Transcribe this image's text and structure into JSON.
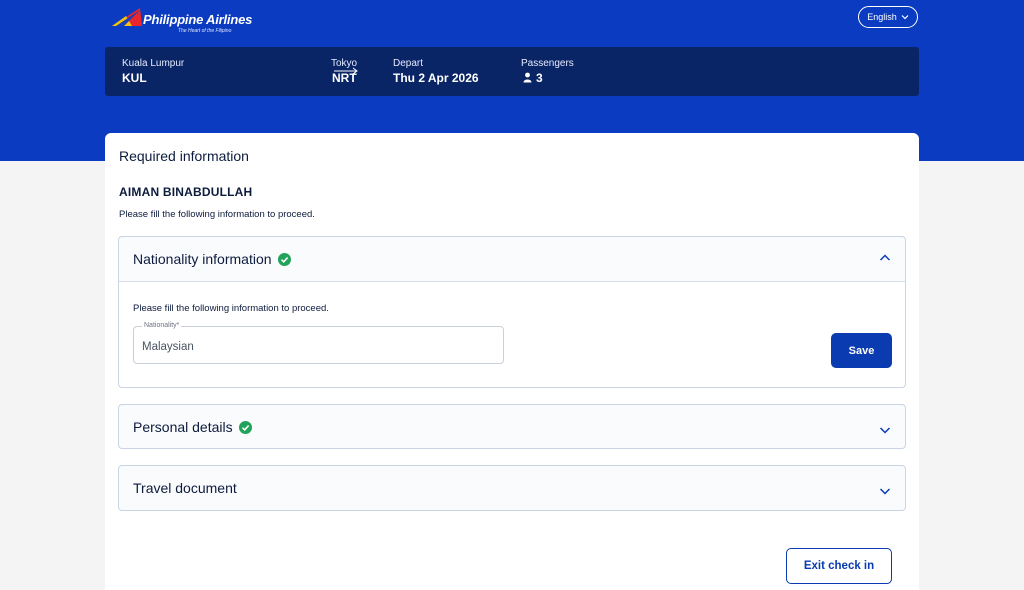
{
  "header": {
    "brand": "Philippine Airlines",
    "tagline": "The Heart of the Filipino",
    "language": "English"
  },
  "trip": {
    "origin_city": "Kuala Lumpur",
    "origin_code": "KUL",
    "destination_city": "Tokyo",
    "destination_code": "NRT",
    "depart_label": "Depart",
    "depart_date": "Thu 2 Apr 2026",
    "passengers_label": "Passengers",
    "passengers_count": "3"
  },
  "main": {
    "title": "Required information",
    "passenger_name": "AIMAN BINABDULLAH",
    "instruction": "Please fill the following information to proceed.",
    "sections": [
      {
        "title": "Nationality information",
        "completed": true,
        "expanded": true,
        "instruction": "Please fill the following information to proceed.",
        "field_label": "Nationality*",
        "field_value": "Malaysian",
        "save_label": "Save"
      },
      {
        "title": "Personal details",
        "completed": true,
        "expanded": false
      },
      {
        "title": "Travel document",
        "completed": false,
        "expanded": false
      }
    ],
    "exit_label": "Exit check in"
  },
  "colors": {
    "brand_blue": "#0a3bc0",
    "navy": "#0a2566",
    "success": "#22a35a"
  }
}
